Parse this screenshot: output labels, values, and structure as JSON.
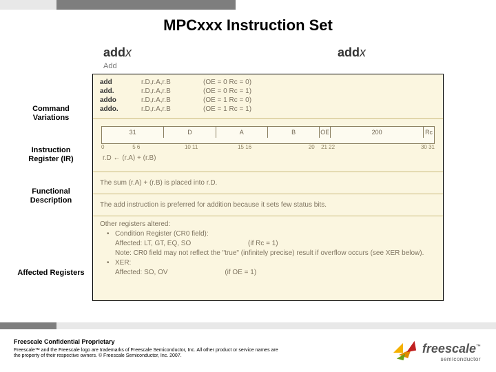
{
  "title": "MPCxxx Instruction Set",
  "mnemonic": {
    "base": "add",
    "suffix": "x"
  },
  "mnemonic_right": {
    "base": "add",
    "suffix": "x"
  },
  "subname": "Add",
  "labels": {
    "command_variations": "Command Variations",
    "instruction_register": "Instruction Register (IR)",
    "functional_description": "Functional Description",
    "affected_registers": "Affected Registers"
  },
  "variants": [
    {
      "mn": "add",
      "args": "r.D,r.A,r.B",
      "cond": "(OE = 0 Rc = 0)"
    },
    {
      "mn": "add.",
      "args": "r.D,r.A,r.B",
      "cond": "(OE = 0 Rc = 1)"
    },
    {
      "mn": "addo",
      "args": "r.D,r.A,r.B",
      "cond": "(OE = 1 Rc = 0)"
    },
    {
      "mn": "addo.",
      "args": "r.D,r.A,r.B",
      "cond": "(OE = 1 Rc = 1)"
    }
  ],
  "ir": {
    "fields": [
      "31",
      "D",
      "A",
      "B",
      "OE",
      "200",
      "Rc"
    ],
    "bits": {
      "left": "0",
      "p56": "5 6",
      "p1011": "10 11",
      "p1516": "15 16",
      "p20": "20",
      "p2122": "21 22",
      "p3031": "30 31"
    }
  },
  "formula": "r.D ← (r.A) + (r.B)",
  "func": {
    "l1": "The sum (r.A) + (r.B) is placed into r.D.",
    "l2": "The add instruction is preferred for addition because it sets few status bits."
  },
  "affected": {
    "head": "Other registers altered:",
    "b1_head": "Condition Register (CR0 field):",
    "b1_aff": "Affected: LT, GT, EQ, SO",
    "b1_cond": "(if Rc = 1)",
    "b1_note": "Note: CR0 field may not reflect the \"true\" (infinitely precise) result if overflow occurs (see XER below).",
    "b2_head": "XER:",
    "b2_aff": "Affected: SO, OV",
    "b2_cond": "(if OE = 1)"
  },
  "footer": {
    "head": "Freescale Confidential Proprietary",
    "l1": "Freescale™ and the Freescale logo are trademarks of Freescale Semiconductor, Inc. All other product or service names are",
    "l2": "the property of their respective owners. © Freescale Semiconductor, Inc. 2007."
  },
  "logo": {
    "word": "freescale",
    "tm": "™",
    "sub": "semiconductor"
  }
}
